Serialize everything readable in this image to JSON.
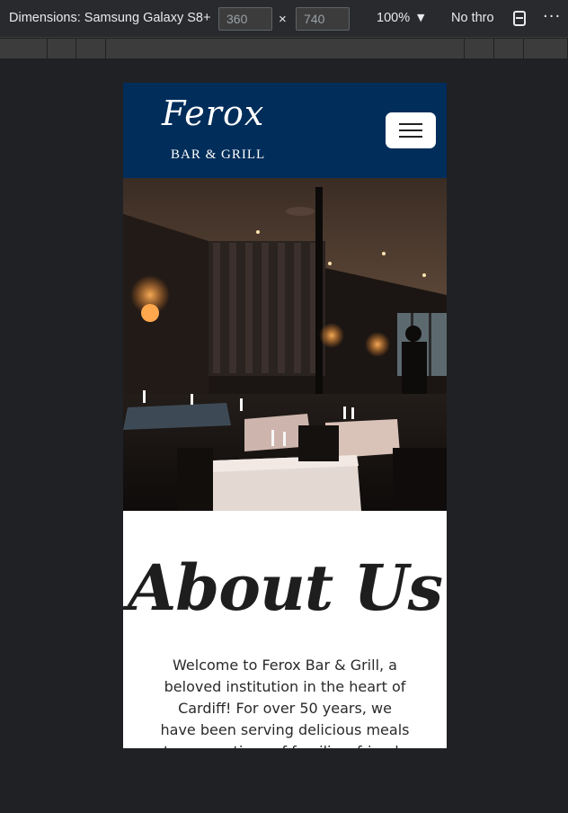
{
  "devtools": {
    "dimensions_label": "Dimensions: Samsung Galaxy S8+",
    "width_value": "360",
    "height_value": "740",
    "times_symbol": "×",
    "zoom": "100%",
    "throttle": "No thro",
    "more_symbol": "⋮"
  },
  "site": {
    "logo_script": "Ferox",
    "logo_subtitle": "BAR & GRILL",
    "nav_color": "#002d5a",
    "about_title": "About Us",
    "about_text": "Welcome to Ferox Bar & Grill, a beloved institution in the heart of Cardiff! For over 50 years, we have been serving delicious meals to generations of families, friends and"
  }
}
